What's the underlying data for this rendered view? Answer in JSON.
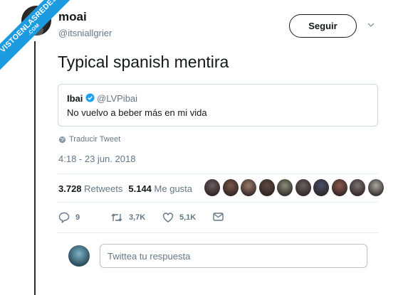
{
  "watermark": {
    "line1": "VISTOENLASREDES",
    "line2": ".COM"
  },
  "tweet": {
    "display_name": "moai",
    "handle": "@itsniallgrier",
    "follow_label": "Seguir",
    "text": "Typical spanish mentira",
    "quote": {
      "name": "Ibai",
      "handle": "@LVPibai",
      "text": "No vuelvo a beber más en mi vida"
    },
    "translate_label": "Traducir Tweet",
    "timestamp": "4:18 - 23 jun. 2018"
  },
  "stats": {
    "retweets_count": "3.728",
    "retweets_label": "Retweets",
    "likes_count": "5.144",
    "likes_label": "Me gusta"
  },
  "liker_colors": [
    "#6b5b5e",
    "#7a5a4a",
    "#9b7b6a",
    "#5e4a3f",
    "#8a8f7a",
    "#6a6260",
    "#4a4f6b",
    "#8a5a4f",
    "#7a7470",
    "#a8a8a0"
  ],
  "actions": {
    "replies": "9",
    "retweets": "3,7K",
    "likes": "5,1K"
  },
  "reply": {
    "placeholder": "Twittea tu respuesta"
  },
  "colors": {
    "accent": "#1da1f2",
    "muted": "#657786",
    "text": "#14171a"
  },
  "icons": [
    "chevron-down-icon",
    "verified-badge-icon",
    "globe-icon",
    "reply-icon",
    "retweet-icon",
    "heart-icon",
    "message-icon"
  ]
}
